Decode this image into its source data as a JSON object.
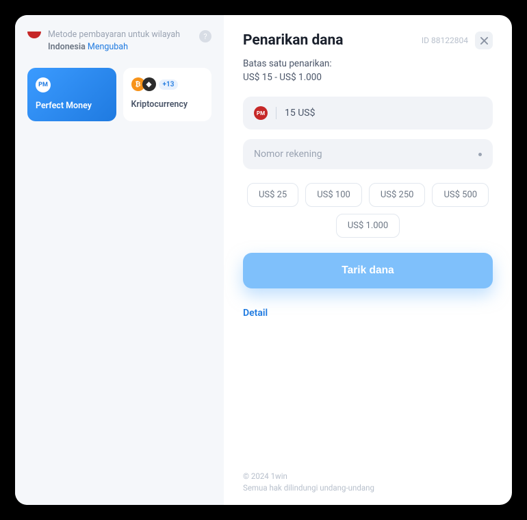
{
  "sidebar": {
    "region_label": "Metode pembayaran untuk wilayah",
    "region_country": "Indonesia",
    "region_change": "Mengubah",
    "help_glyph": "?",
    "methods": [
      {
        "label": "Perfect Money",
        "pm_text": "PM"
      },
      {
        "label": "Kriptocurrency",
        "btc_glyph": "₿",
        "eth_glyph": "◆",
        "badge": "+13"
      }
    ]
  },
  "header": {
    "title": "Penarikan dana",
    "id_text": "ID 88122804"
  },
  "limits": {
    "line1": "Batas satu penarikan:",
    "line2": "US$ 15 - US$ 1.000"
  },
  "amount_field": {
    "pm_text": "PM",
    "value": "15 US$"
  },
  "account_field": {
    "placeholder": "Nomor rekening"
  },
  "presets": [
    "US$ 25",
    "US$ 100",
    "US$ 250",
    "US$ 500",
    "US$ 1.000"
  ],
  "submit_label": "Tarik dana",
  "detail_label": "Detail",
  "footer": {
    "line1": "© 2024 1win",
    "line2": "Semua hak dilindungi undang-undang"
  }
}
